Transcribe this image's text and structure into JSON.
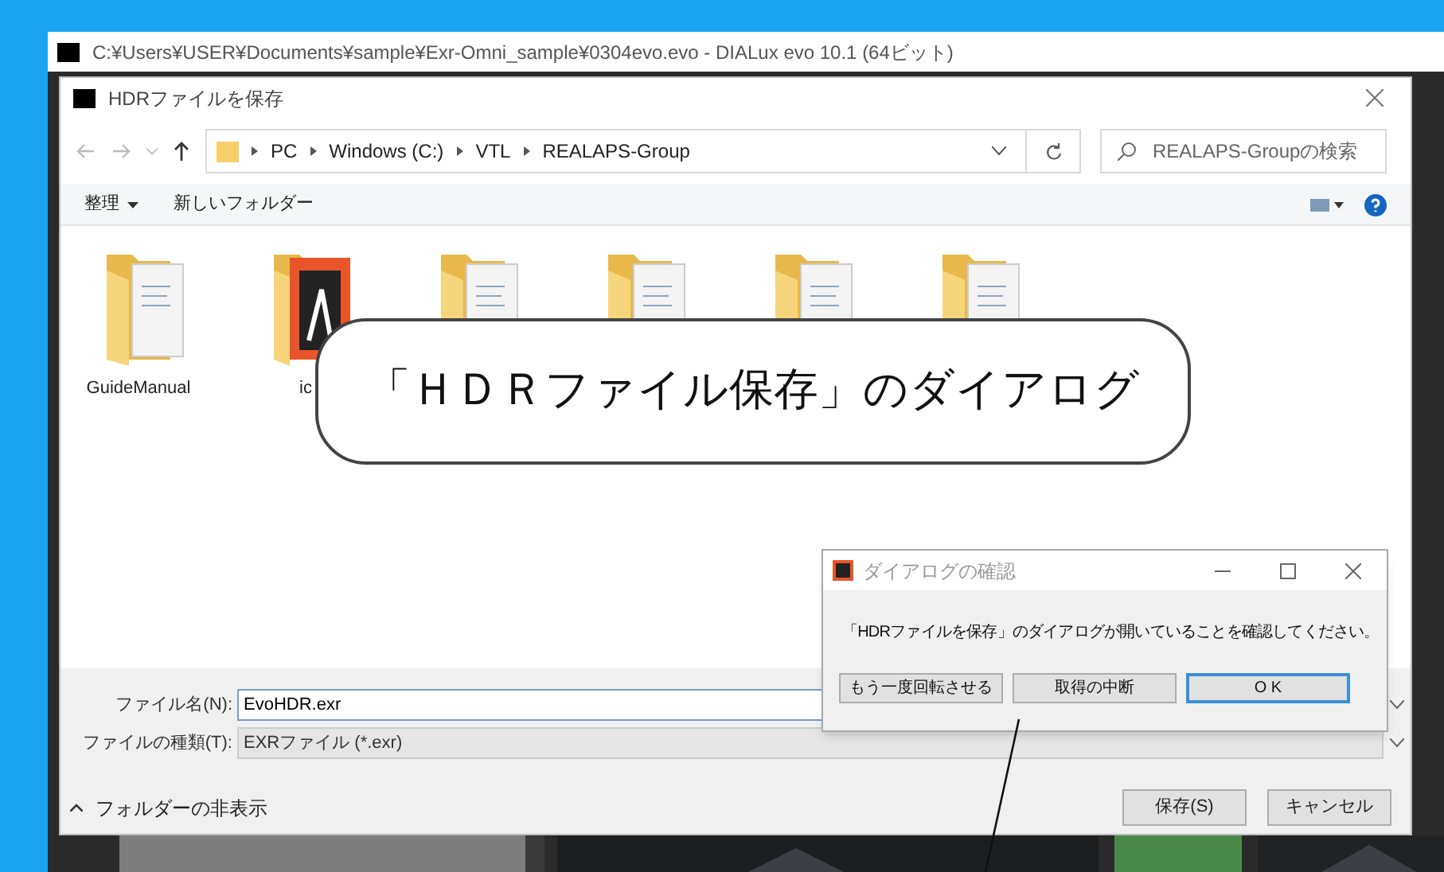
{
  "app_window": {
    "title": "C:¥Users¥USER¥Documents¥sample¥Exr-Omni_sample¥0304evo.evo - DIALux evo 10.1 (64ビット)"
  },
  "save_dialog": {
    "title": "HDRファイルを保存",
    "breadcrumb": [
      "PC",
      "Windows (C:)",
      "VTL",
      "REALAPS-Group"
    ],
    "search": {
      "placeholder": "REALAPS-Groupの検索"
    },
    "toolbar": [
      {
        "label": "整理",
        "menu": true
      },
      {
        "label": "新しいフォルダー",
        "menu": false
      }
    ],
    "files": [
      {
        "name": "GuideManual",
        "kind": "doc"
      },
      {
        "name": "ic",
        "kind": "app"
      },
      {
        "kind": "doc"
      },
      {
        "kind": "doc"
      },
      {
        "kind": "doc"
      },
      {
        "kind": "doc"
      }
    ],
    "file_name": {
      "label": "ファイル名(N):",
      "value": "EvoHDR.exr"
    },
    "file_type": {
      "label": "ファイルの種類(T):",
      "value": "EXRファイル (*.exr)"
    },
    "hide_folders": "フォルダーの非表示",
    "buttons": [
      "保存(S)",
      "キャンセル"
    ]
  },
  "callout": {
    "text": "「ＨＤＲファイル保存」のダイアログ"
  },
  "confirm_dialog": {
    "title": "ダイアログの確認",
    "message": "「HDRファイルを保存」のダイアログが開いていることを確認してください。",
    "buttons": [
      {
        "label": "もう一度回転させる",
        "selected": false
      },
      {
        "label": "取得の中断",
        "selected": false
      },
      {
        "label": "O K",
        "selected": true
      }
    ]
  }
}
